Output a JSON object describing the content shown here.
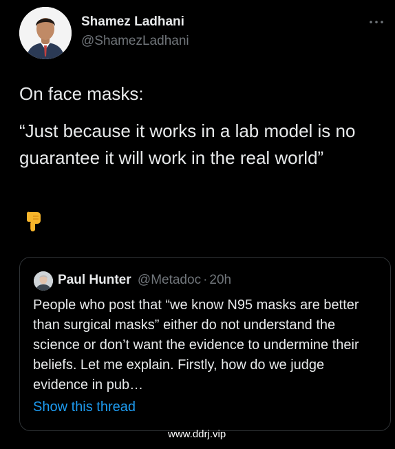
{
  "author": {
    "name": "Shamez Ladhani",
    "handle": "@ShamezLadhani",
    "avatar_icon": "person-photo-avatar"
  },
  "menu": {
    "icon": "more-options-icon"
  },
  "tweet": {
    "line1": "On face masks:",
    "line2": "“Just because it works in a lab model is no guarantee it will work in the real world”",
    "emoji_icon": "backhand-index-pointing-down-emoji"
  },
  "quote": {
    "avatar_icon": "person-photo-avatar",
    "name": "Paul Hunter",
    "handle": "@Metadoc",
    "separator": "·",
    "time": "20h",
    "text": "People who post that “we know N95 masks are better than surgical masks” either do not understand the science or don’t want the evidence to undermine their beliefs. Let me explain. Firstly, how do we judge evidence in pub…",
    "show_thread": "Show this thread"
  },
  "watermark": "www.ddrj.vip",
  "colors": {
    "background": "#000000",
    "text": "#e7e9ea",
    "secondary_text": "#71767b",
    "link": "#1d9bf0",
    "border": "#2f3336"
  }
}
